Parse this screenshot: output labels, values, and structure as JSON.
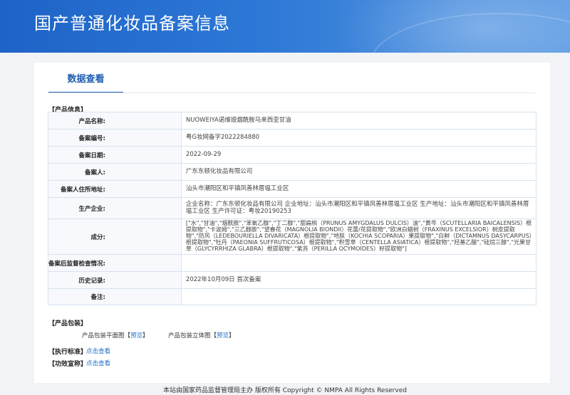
{
  "header": {
    "title": "国产普通化妆品备案信息"
  },
  "tab": {
    "label": "数据查看"
  },
  "product_info": {
    "section_title": "【产品信息】",
    "rows": [
      {
        "label": "产品名称:",
        "value": "NUOWEIYA诺维娅烟酰胺马来西亚甘油"
      },
      {
        "label": "备案编号:",
        "value": "粤G妆网备字2022284880"
      },
      {
        "label": "备案日期:",
        "value": "2022-09-29"
      },
      {
        "label": "备案人:",
        "value": "广东东顿化妆品有限公司"
      },
      {
        "label": "备案人住所地址:",
        "value": "汕头市潮阳区和平镇凤善林厝塭工业区"
      },
      {
        "label": "生产企业:",
        "value": "企业名称：广东东顿化妆品有限公司 企业地址：汕头市潮阳区和平镇凤善林厝塭工业区 生产地址：汕头市潮阳区和平镇凤善林厝塭工业区 生产许可证：粤妆20190253"
      },
      {
        "label": "成分:",
        "value": "[\"水\",\"甘油\",\"烟酰胺\",\"苯氧乙醇\",\"丁二醇\",\"甜扁桃（PRUNUS AMYGDALUS DULCIS）油\",\"黄芩（SCUTELLARIA BAICALENSIS）根提取物\",\"卡波姆\",\"三乙醇胺\",\"望春花（MAGNOLIA BIONDII）花蕾/花提取物\",\"欧洲白蜡树（FRAXINUS EXCELSIOR）树皮提取物\",\"防风（LEDEBOURIELLA DIVARICATA）根提取物\",\"地肤（KOCHIA SCOPARIA）果提取物\",\"白鲜（DICTAMNUS DASYCARPUS）根提取物\",\"牡丹（PAEONIA SUFFRUTICOSA）根提取物\",\"积雪草（CENTELLA ASIATICA）根提取物\",\"羟基乙酸\",\"硅烷三醇\",\"光果甘草（GLYCYRRHIZA GLABRA）根提取物\",\"紫苏（PERILLA OCYMOIDES）籽提取物\"]"
      },
      {
        "label": "备案后监督检查情况:",
        "value": ""
      },
      {
        "label": "历史记录:",
        "value": "2022年10月09日 首次备案"
      },
      {
        "label": "备注:",
        "value": ""
      }
    ]
  },
  "packaging": {
    "section_title": "【产品包装】",
    "flat_label": "产品包装平面图",
    "flat_link": "预览",
    "solid_label": "产品包装立体图",
    "solid_link": "预览"
  },
  "standard": {
    "section_title": "【执行标准】",
    "link": "点击查看"
  },
  "efficacy": {
    "section_title": "【功效宣称】",
    "link": "点击查看"
  },
  "footer": {
    "text": "本站由国家药品监督管理局主办 版权所有 Copyright © NMPA All Rights Reserved"
  }
}
